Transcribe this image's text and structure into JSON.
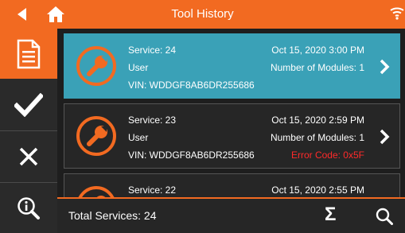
{
  "header": {
    "title": "Tool History"
  },
  "sidebar": {
    "items": [
      "document-icon",
      "check-icon",
      "close-icon",
      "search-detail-icon"
    ]
  },
  "colors": {
    "accent": "#f26a21",
    "selected": "#3aa1b7",
    "error": "#ff2a2a"
  },
  "services": [
    {
      "service": "Service: 24",
      "user": "User",
      "vin": "VIN: WDDGF8AB6DR255686",
      "datetime": "Oct 15, 2020 3:00 PM",
      "modules": "Number of Modules: 1",
      "error": ""
    },
    {
      "service": "Service: 23",
      "user": "User",
      "vin": "VIN: WDDGF8AB6DR255686",
      "datetime": "Oct 15, 2020 2:59 PM",
      "modules": "Number of Modules: 1",
      "error": "Error Code: 0x5F"
    },
    {
      "service": "Service: 22",
      "user": "",
      "vin": "",
      "datetime": "Oct 15, 2020 2:55 PM",
      "modules": "",
      "error": ""
    }
  ],
  "footer": {
    "total": "Total Services: 24",
    "sigma": "Σ"
  }
}
